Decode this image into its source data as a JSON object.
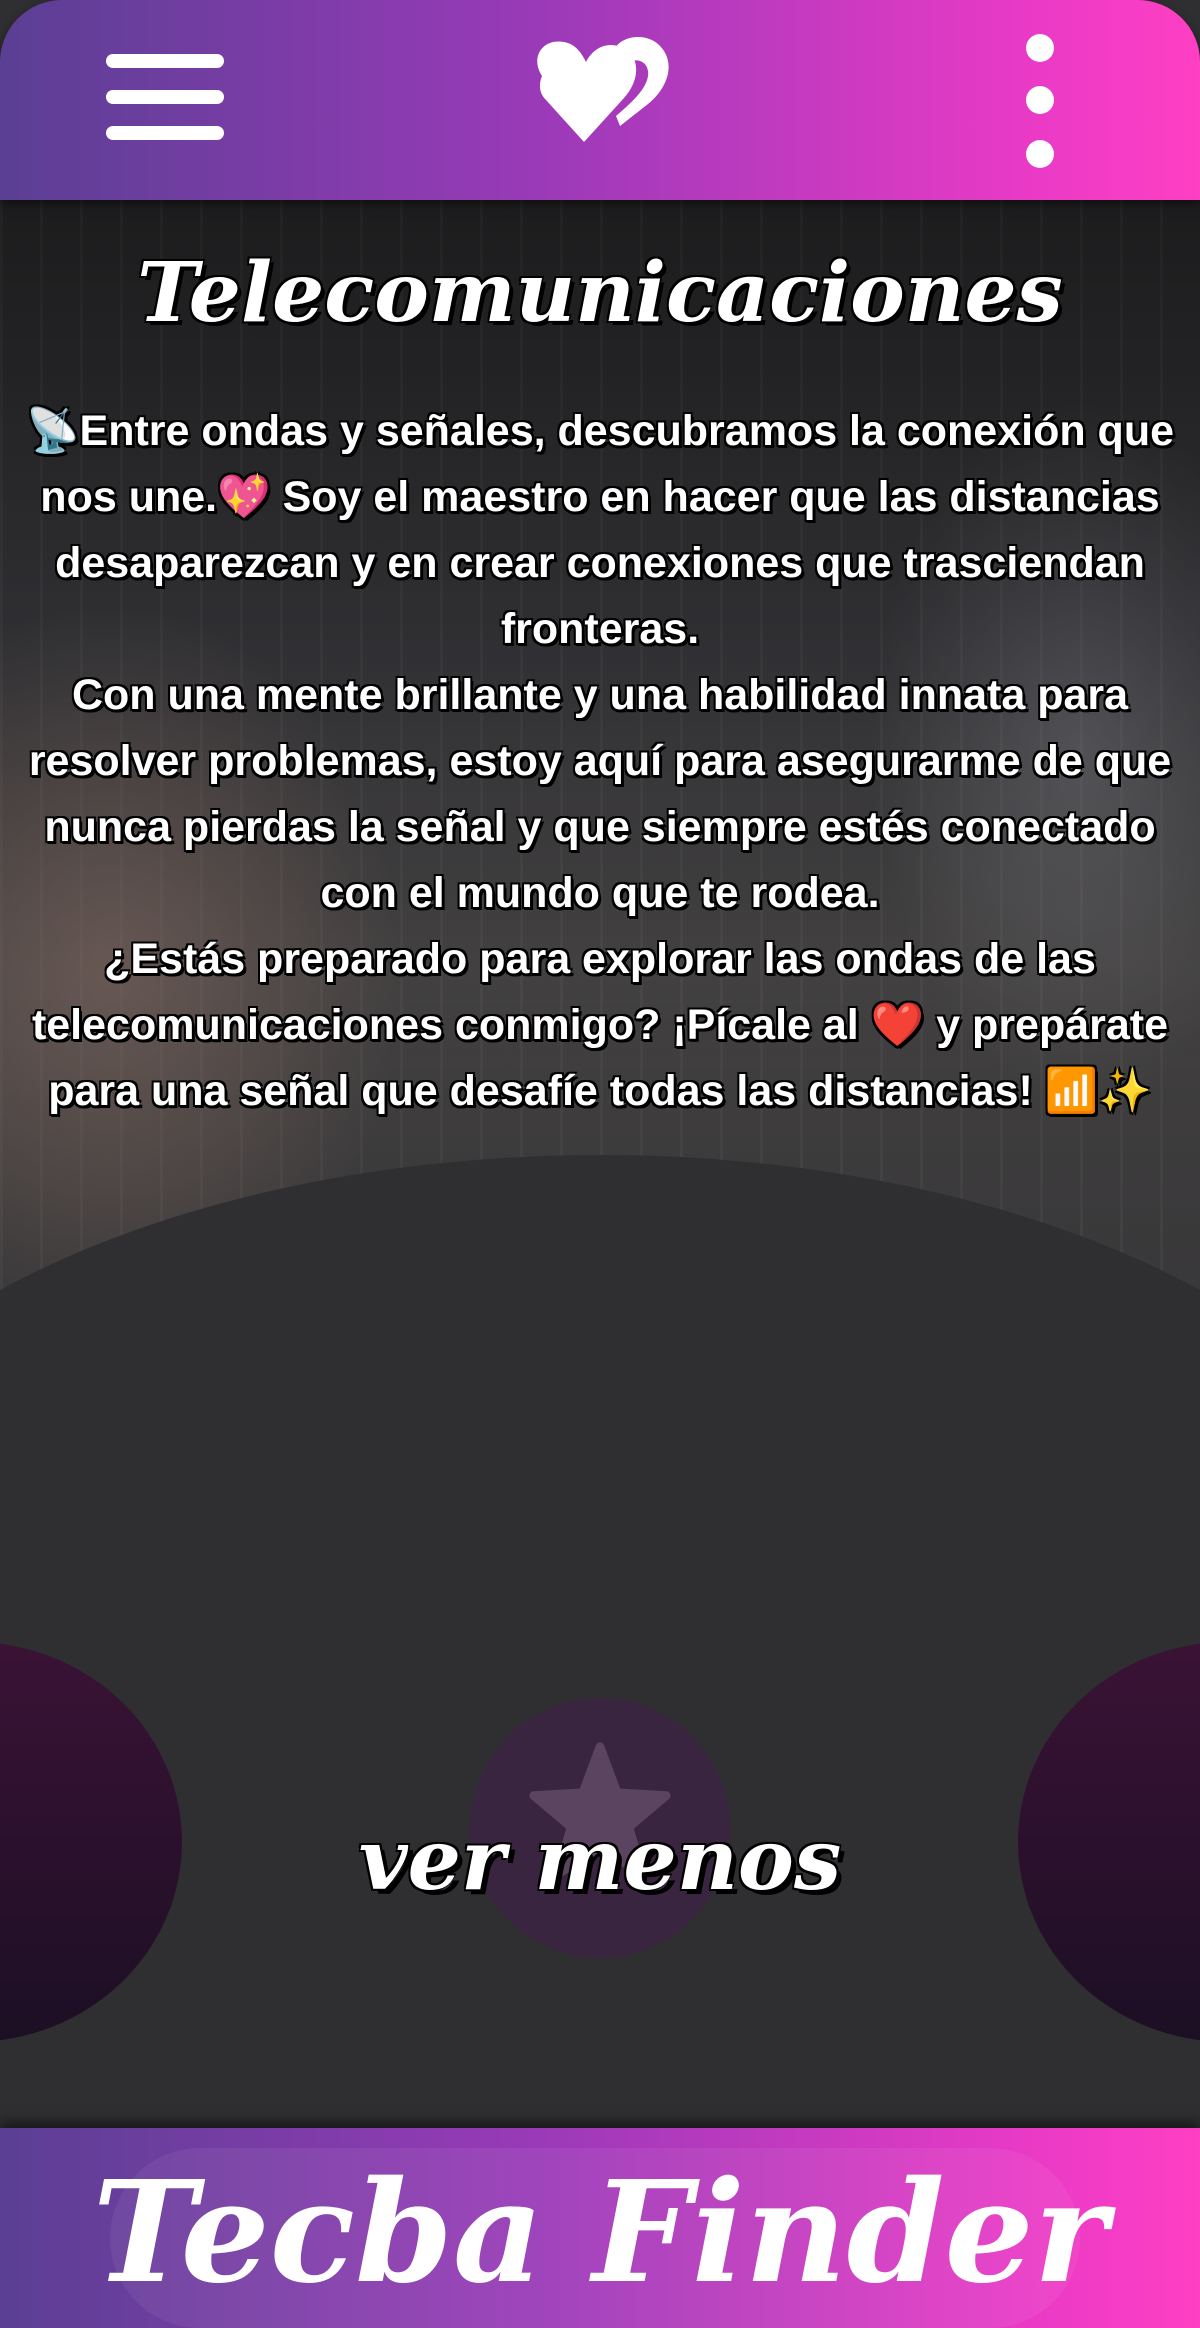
{
  "header": {
    "menu_icon": "hamburger-menu-icon",
    "logo_icon": "double-heart-logo-icon",
    "more_icon": "vertical-dots-icon"
  },
  "profile": {
    "title": "Telecomunicaciones",
    "description": "📡Entre ondas y señales, descubramos la conexión que nos une.💖 Soy el maestro en hacer que las distancias desaparezcan y en crear conexiones que trasciendan fronteras.\nCon una mente brillante y una habilidad innata para resolver problemas, estoy aquí para asegurarme de que nunca pierdas la señal y que siempre estés conectado  con el mundo que te rodea.\n¿Estás preparado para explorar las ondas de las telecomunicaciones conmigo? ¡Pícale al ❤️ y prepárate para una señal que desafíe todas las distancias! 📶✨",
    "toggle_label": "ver menos",
    "favorite_icon": "star-icon"
  },
  "footer": {
    "brand": "Tecba Finder"
  },
  "colors": {
    "gradient_start": "#5a3f94",
    "gradient_end": "#ff3fc4",
    "panel_bg": "#2f2e31",
    "blob": "#3a1235"
  }
}
